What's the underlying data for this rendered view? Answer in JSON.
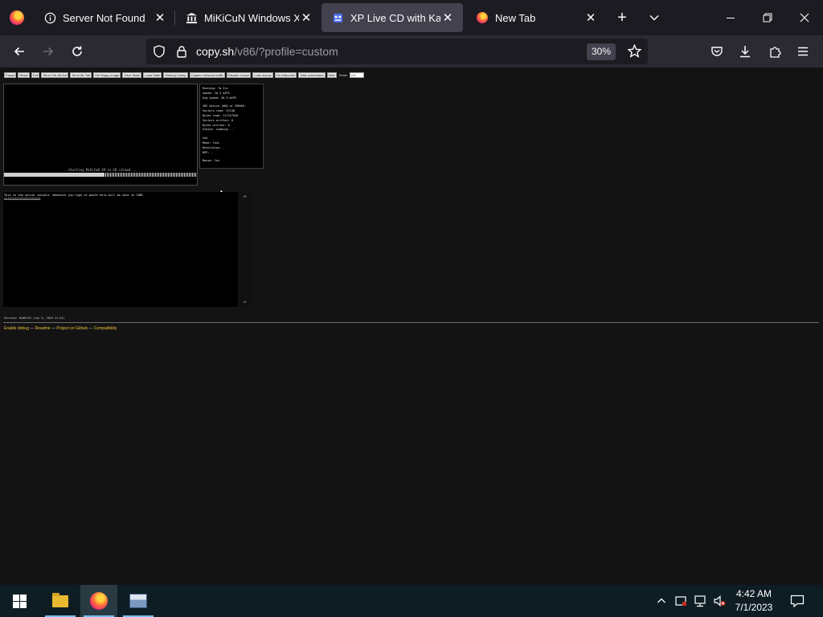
{
  "tabs": [
    {
      "icon": "info-icon",
      "title": "Server Not Found",
      "active": false
    },
    {
      "icon": "museum-icon",
      "title": "MiKiCuN Windows XP |",
      "active": false
    },
    {
      "icon": "v86-icon",
      "title": "XP Live CD with Kapers",
      "active": true
    },
    {
      "icon": "firefox-icon",
      "title": "New Tab",
      "active": false
    }
  ],
  "nav": {
    "url_host": "copy.sh",
    "url_path": "/v86/?profile=custom",
    "zoom": "30%"
  },
  "v86": {
    "buttons": [
      "Pause",
      "Reset",
      "Exit",
      "Send Ctrl-Alt-Del",
      "Send Alt-Tab",
      "Get floppy image",
      "Save State",
      "Load State",
      "Memory Dump",
      "Capture network traffic",
      "Disable mouse",
      "Lock mouse",
      "Go fullscreen",
      "Take screenshot",
      "Hide"
    ],
    "scale_label": "Scale:",
    "scale_value": "1.0",
    "screen_text": "...Starting MiKiCuN XP-in-CD v3rmod ...",
    "info_lines": [
      "Running: 7m 21s",
      "Speed: 10.3 mIPS",
      "Avg speed: 58.9 mIPS",
      "",
      "IDE device (HDA or CDROM):",
      "Sectors read: 57130",
      "Bytes read: 117227520",
      "Sectors written: 0",
      "Bytes written: 0",
      "Status: Loading ...",
      "",
      "VGA",
      "Mode: Text",
      "Resolution: -",
      "BPP: -",
      "",
      "Mouse: Yes"
    ],
    "serial_text": "This is the serial console. Whatever you type or paste here will be sent to COM1",
    "serial_line2": "ÃÃÃÃÃÃÃÃÃÃÃÃÃÃÃÃÃÃÃÃÃ",
    "version": "Version: 82d8f16 (Jun 5, 2023 21:01)",
    "links": [
      "Enable debug",
      "Readme",
      "Project on Github",
      "Compatibility"
    ]
  },
  "taskbar": {
    "time": "4:42 AM",
    "date": "7/1/2023"
  },
  "colors": {
    "tab_strip": "#1c1b22",
    "toolbar": "#2b2a33",
    "page_bg": "#131313",
    "link": "#f0c040",
    "taskbar": "#0e1d24"
  }
}
